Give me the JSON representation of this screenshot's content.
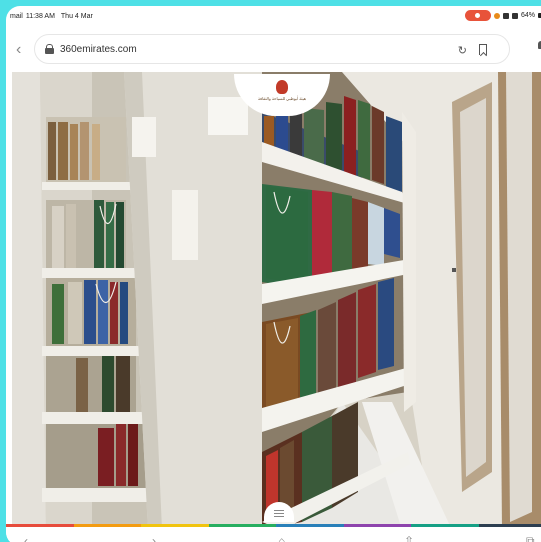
{
  "status_bar": {
    "carrier": "mail",
    "time": "11:38 AM",
    "date": "Thu 4 Mar",
    "battery": "64%"
  },
  "browser": {
    "url": "360emirates.com",
    "back_icon": "chevron-left-icon",
    "reload_icon": "reload-icon",
    "bookmark_icon": "bookmark-icon",
    "profile_icon": "profile-icon"
  },
  "viewer": {
    "logo_text": "هيئة أبوظبي للسياحة والثقافة"
  },
  "accent_strip_colors": [
    "#e74c3c",
    "#f39c12",
    "#f1c40f",
    "#27ae60",
    "#2980b9",
    "#8e44ad",
    "#16a085",
    "#2c3e50"
  ],
  "bottom_bar": {
    "back_icon": "chevron-left-icon",
    "forward_icon": "chevron-right-icon",
    "home_icon": "home-icon",
    "share_icon": "share-icon",
    "tabs_icon": "tabs-icon"
  }
}
